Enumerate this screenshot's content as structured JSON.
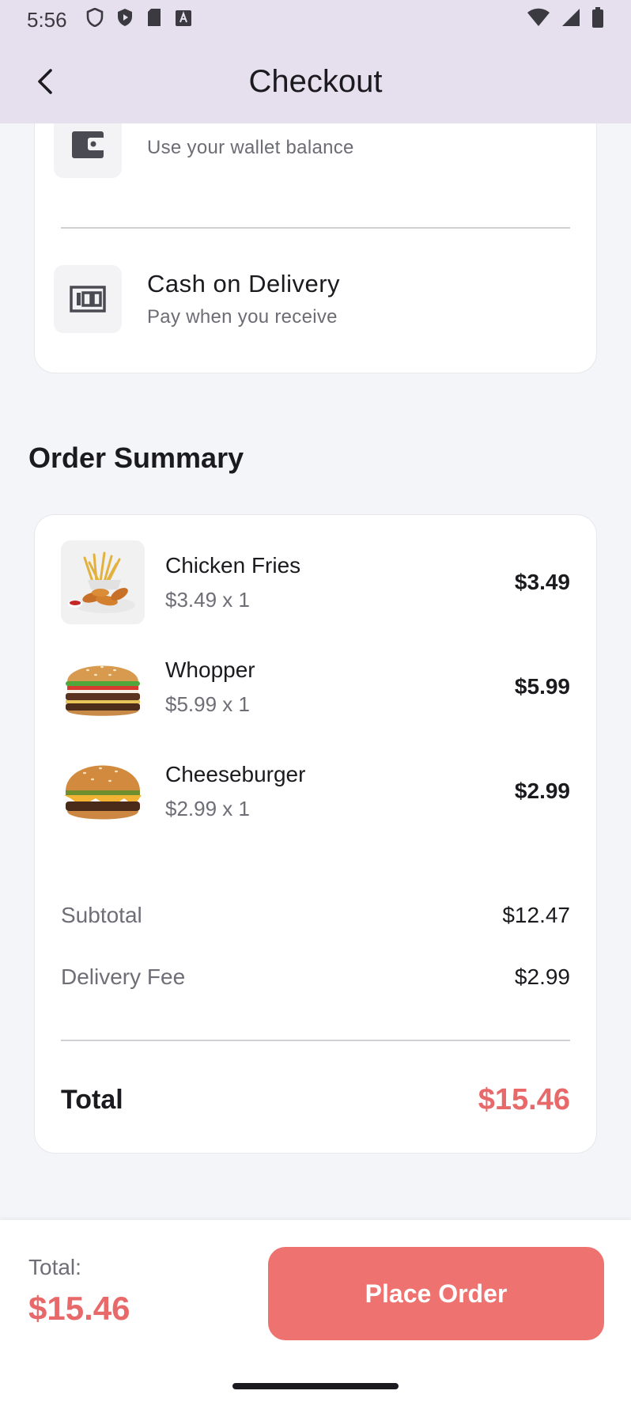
{
  "status_bar": {
    "time": "5:56",
    "left_icons": [
      "shield-icon",
      "play-protect-icon",
      "sd-card-icon",
      "text-a-icon"
    ],
    "right_icons": [
      "wifi-icon",
      "signal-icon",
      "battery-icon"
    ]
  },
  "app_bar": {
    "title": "Checkout"
  },
  "payment_methods": [
    {
      "title": "",
      "subtitle": "Use your wallet balance",
      "icon": "wallet-icon"
    },
    {
      "title": "Cash on Delivery",
      "subtitle": "Pay when you receive",
      "icon": "cash-icon"
    }
  ],
  "order_summary": {
    "heading": "Order Summary",
    "items": [
      {
        "name": "Chicken Fries",
        "qty_text": "$3.49 x 1",
        "price": "$3.49",
        "image": "chicken-fries-image"
      },
      {
        "name": "Whopper",
        "qty_text": "$5.99 x 1",
        "price": "$5.99",
        "image": "whopper-image"
      },
      {
        "name": "Cheeseburger",
        "qty_text": "$2.99 x 1",
        "price": "$2.99",
        "image": "cheeseburger-image"
      }
    ],
    "subtotal_label": "Subtotal",
    "subtotal_value": "$12.47",
    "delivery_label": "Delivery Fee",
    "delivery_value": "$2.99",
    "total_label": "Total",
    "total_value": "$15.46"
  },
  "bottom_bar": {
    "total_label": "Total:",
    "total_value": "$15.46",
    "place_order_label": "Place Order"
  },
  "colors": {
    "accent": "#EE7370",
    "total_text": "#E8696A",
    "app_bar": "#E6E0EE",
    "background": "#F4F5F8"
  }
}
